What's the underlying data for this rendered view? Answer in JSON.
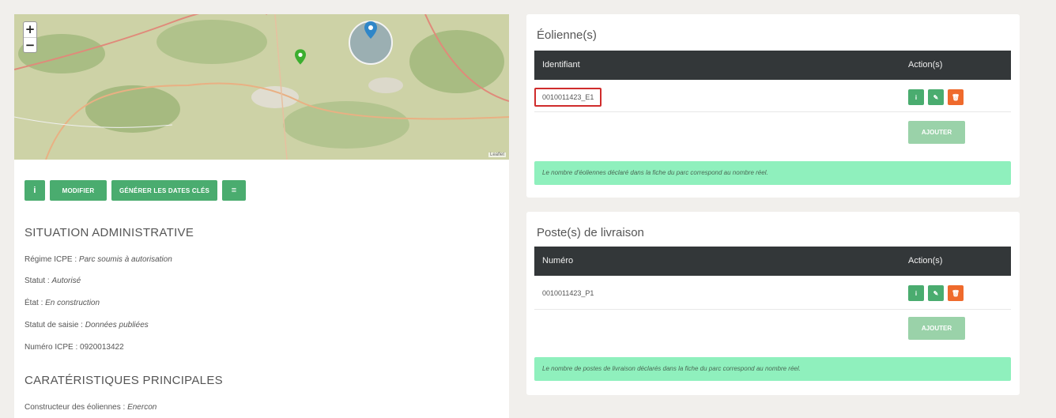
{
  "map": {
    "zoom_in": "+",
    "zoom_out": "−",
    "attribution": "Leaflet"
  },
  "toolbar": {
    "info_label": "i",
    "edit_label": "MODIFIER",
    "generate_label": "GÉNÉRER LES DATES CLÉS",
    "menu_label": "≡"
  },
  "situation": {
    "title": "SITUATION ADMINISTRATIVE",
    "lines": [
      {
        "label": "Régime ICPE : ",
        "value": "Parc soumis à autorisation"
      },
      {
        "label": "Statut : ",
        "value": "Autorisé"
      },
      {
        "label": "État : ",
        "value": "En construction"
      },
      {
        "label": "Statut de saisie : ",
        "value": "Données publiées"
      },
      {
        "label": "Numéro ICPE : ",
        "value": "0920013422"
      }
    ]
  },
  "characteristics": {
    "title": "CARATÉRISTIQUES PRINCIPALES",
    "lines": [
      {
        "label": "Constructeur des éoliennes : ",
        "value": "Enercon"
      }
    ]
  },
  "eoliennes": {
    "title": "Éolienne(s)",
    "col_id": "Identifiant",
    "col_actions": "Action(s)",
    "rows": [
      "0010011423_E1"
    ],
    "add_label": "AJOUTER",
    "note": "Le nombre d'éoliennes déclaré dans la fiche du parc correspond au nombre réel."
  },
  "postes": {
    "title": "Poste(s) de livraison",
    "col_id": "Numéro",
    "col_actions": "Action(s)",
    "rows": [
      "0010011423_P1"
    ],
    "add_label": "AJOUTER",
    "note": "Le nombre de postes de livraison déclarés dans la fiche du parc correspond au nombre réel."
  },
  "action_icons": {
    "info": "i",
    "edit": "✎",
    "delete": "🗑"
  },
  "colors": {
    "primary_green": "#4aac6f",
    "danger_orange": "#ef6a2c",
    "header_dark": "#333739",
    "note_green": "#8ff0bd",
    "highlight_red": "#d02c2c"
  }
}
